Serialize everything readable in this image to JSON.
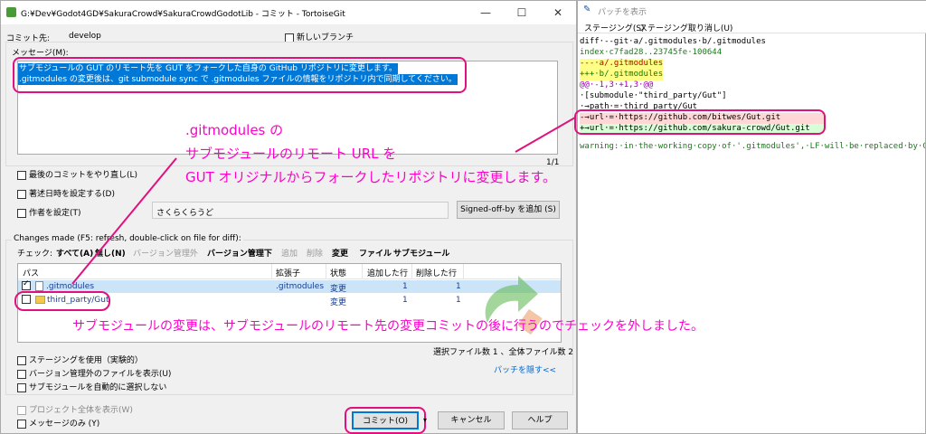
{
  "commit_window": {
    "title": "G:¥Dev¥Godot4GD¥SakuraCrowd¥SakuraCrowdGodotLib - コミット - TortoiseGit",
    "commit_to_label": "コミット先:",
    "branch": "develop",
    "new_branch_label": "新しいブランチ",
    "message_label": "メッセージ(M):",
    "message_lines": [
      "サブモジュールの GUT のリモート先を GUT をフォークした自身の GitHub リポジトリに変更します。",
      ".gitmodules の変更後は、git submodule sync で .gitmodules ファイルの情報をリポジトリ内で同期してください。"
    ],
    "line_counter": "1/1",
    "amend_label": "最後のコミットをやり直し(L)",
    "set_date_label": "著述日時を設定する(D)",
    "set_author_label": "作者を設定(T)",
    "author_value": "さくらくらうど",
    "signoff_button": "Signed-off-by を追加 (S)",
    "changes_header": "Changes made (F5: refresh, double-click on file for diff):",
    "check_label": "チェック:",
    "filters": [
      "すべて(A)",
      "無し(N)",
      "バージョン管理外",
      "バージョン管理下",
      "追加",
      "削除",
      "変更",
      "ファイル",
      "サブモジュール"
    ],
    "columns": [
      "パス",
      "拡張子",
      "状態",
      "追加した行",
      "削除した行"
    ],
    "files": [
      {
        "path": ".gitmodules",
        "ext": ".gitmodules",
        "status": "変更",
        "added": "1",
        "deleted": "1",
        "checked": true
      },
      {
        "path": "third_party/Gut",
        "ext": "",
        "status": "変更",
        "added": "1",
        "deleted": "1",
        "checked": false
      }
    ],
    "selection_summary": "選択ファイル数 1 、全体ファイル数 2",
    "hide_patch_link": "パッチを隠す<<",
    "staging_label": "ステージングを使用（実験的）",
    "show_unversioned_label": "バージョン管理外のファイルを表示(U)",
    "auto_select_submodules_label": "サブモジュールを自動的に選択しない",
    "show_whole_project_label": "プロジェクト全体を表示(W)",
    "message_only_label": "メッセージのみ (Y)",
    "commit_button": "コミット(O)",
    "cancel_button": "キャンセル",
    "help_button": "ヘルプ"
  },
  "patch_window": {
    "title": "パッチを表示",
    "menu": [
      "ステージング(S)",
      "ステージング取り消し(U)"
    ],
    "diff_lines": [
      {
        "text": "diff·--git·a/.gitmodules·b/.gitmodules",
        "type": "header"
      },
      {
        "text": "index·c7fad28..23745fe·100644",
        "type": "index"
      },
      {
        "text": "---·a/.gitmodules",
        "type": "file-old"
      },
      {
        "text": "+++·b/.gitmodules",
        "type": "file-new"
      },
      {
        "text": "@@·-1,3·+1,3·@@",
        "type": "hunk"
      },
      {
        "text": "·[submodule·\"third_party/Gut\"]",
        "type": "context"
      },
      {
        "text": "·→path·=·third_party/Gut",
        "type": "context"
      },
      {
        "text": "-→url·=·https://github.com/bitwes/Gut.git",
        "type": "removed"
      },
      {
        "text": "+→url·=·https://github.com/sakura-crowd/Gut.git",
        "type": "added"
      },
      {
        "text": "",
        "type": "context"
      },
      {
        "text": "warning:·in·the·working·copy·of·'.gitmodules',·LF·will·be·replaced·by·C",
        "type": "warning"
      }
    ]
  },
  "annotations": {
    "note1_lines": [
      ".gitmodules の",
      "サブモジュールのリモート URL を",
      "GUT オリジナルからフォークしたリポジトリに変更します。"
    ],
    "note2": "サブモジュールの変更は、サブモジュールのリモート先の変更コミットの後に行うのでチェックを外しました。"
  },
  "colors": {
    "annotation": "#ff00cc",
    "highlight_border": "#e0117f",
    "selection": "#0078d7"
  }
}
